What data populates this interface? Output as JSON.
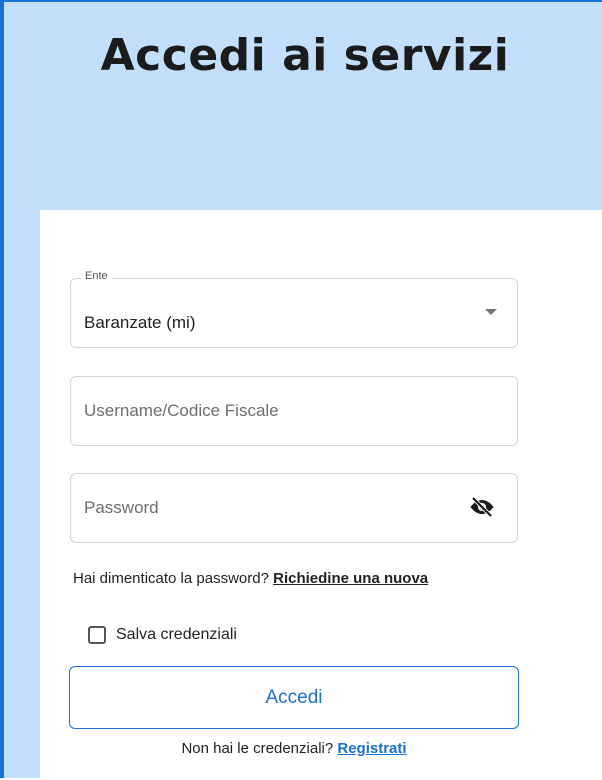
{
  "header": {
    "title": "Accedi ai servizi"
  },
  "form": {
    "ente": {
      "label": "Ente",
      "value": "Baranzate (mi)"
    },
    "username": {
      "placeholder": "Username/Codice Fiscale",
      "value": ""
    },
    "password": {
      "placeholder": "Password",
      "value": "",
      "toggle_icon": "eye-slash-icon"
    },
    "forgot": {
      "text": "Hai dimenticato la password?",
      "link": "Richiedine una nuova"
    },
    "remember": {
      "label": "Salva credenziali",
      "checked": false
    },
    "submit_label": "Accedi",
    "register": {
      "text": "Non hai le credenziali?",
      "link": "Registrati"
    }
  },
  "colors": {
    "background": "#c2e0fb",
    "accent": "#1a6fd0",
    "card": "#ffffff"
  }
}
